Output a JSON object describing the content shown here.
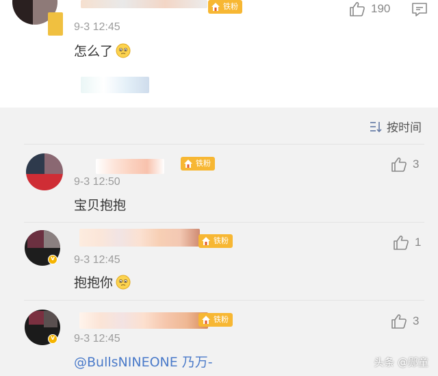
{
  "top_comment": {
    "time": "9-3 12:45",
    "text": "怎么了",
    "likes": "190",
    "fan_badge": "铁粉"
  },
  "sort": {
    "label": "按时间"
  },
  "replies": [
    {
      "time": "9-3 12:50",
      "text": "宝贝抱抱",
      "likes": "3",
      "fan_badge": "铁粉"
    },
    {
      "time": "9-3 12:45",
      "text": "抱抱你",
      "likes": "1",
      "fan_badge": "铁粉"
    },
    {
      "time": "9-3 12:45",
      "text": "@BullsNINEONE 乃万-",
      "likes": "3",
      "fan_badge": "铁粉"
    }
  ],
  "watermark": "头条 @郧童",
  "colors": {
    "badge": "#f7b733",
    "mention": "#4a7ac9",
    "verified": "#f5b400"
  },
  "icons": [
    "thumbs-up-icon",
    "comment-icon",
    "sort-icon",
    "house-icon",
    "verified-icon",
    "emoji-icon"
  ]
}
